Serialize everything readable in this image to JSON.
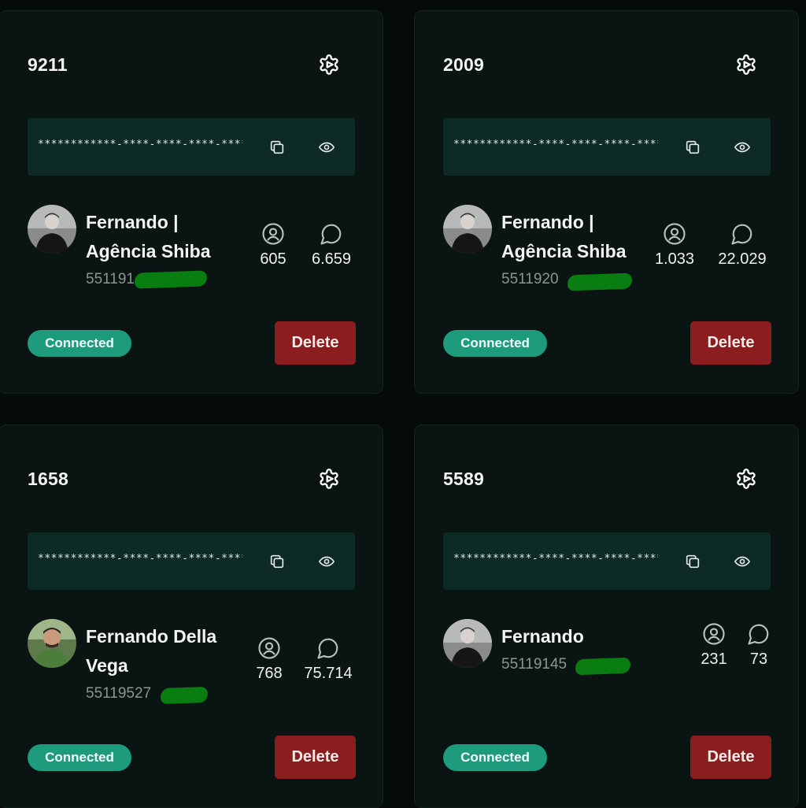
{
  "instances": [
    {
      "id": "9211",
      "token": "************-****-****-****-************",
      "name": "Fernando | Agência Shiba",
      "phone_visible": "551191",
      "contacts": "605",
      "messages": "6.659",
      "status": "Connected",
      "delete_label": "Delete",
      "avatar": "avatar-man-dark-shirt"
    },
    {
      "id": "2009",
      "token": "************-****-****-****-************",
      "name": "Fernando | Agência Shiba",
      "phone_visible": "5511920",
      "contacts": "1.033",
      "messages": "22.029",
      "status": "Connected",
      "delete_label": "Delete",
      "avatar": "avatar-man-dark-shirt"
    },
    {
      "id": "1658",
      "token": "************-****-****-****-************",
      "name": "Fernando Della Vega",
      "phone_visible": "55119527",
      "contacts": "768",
      "messages": "75.714",
      "status": "Connected",
      "delete_label": "Delete",
      "avatar": "avatar-man-green-shirt"
    },
    {
      "id": "5589",
      "token": "************-****-****-****-************",
      "name": "Fernando",
      "phone_visible": "55119145",
      "contacts": "231",
      "messages": "73",
      "status": "Connected",
      "delete_label": "Delete",
      "avatar": "avatar-man-dark-shirt"
    }
  ],
  "icons": {
    "settings": "gear-icon",
    "copy": "copy-icon",
    "show": "eye-icon",
    "contacts": "user-circle-icon",
    "messages": "chat-bubble-icon"
  },
  "colors": {
    "background": "#050b0a",
    "card": "#0a1412",
    "token_box": "#0d2a24",
    "status_badge": "#1e9b7c",
    "delete_button": "#8a1d1d",
    "redaction": "#0a7d12"
  }
}
